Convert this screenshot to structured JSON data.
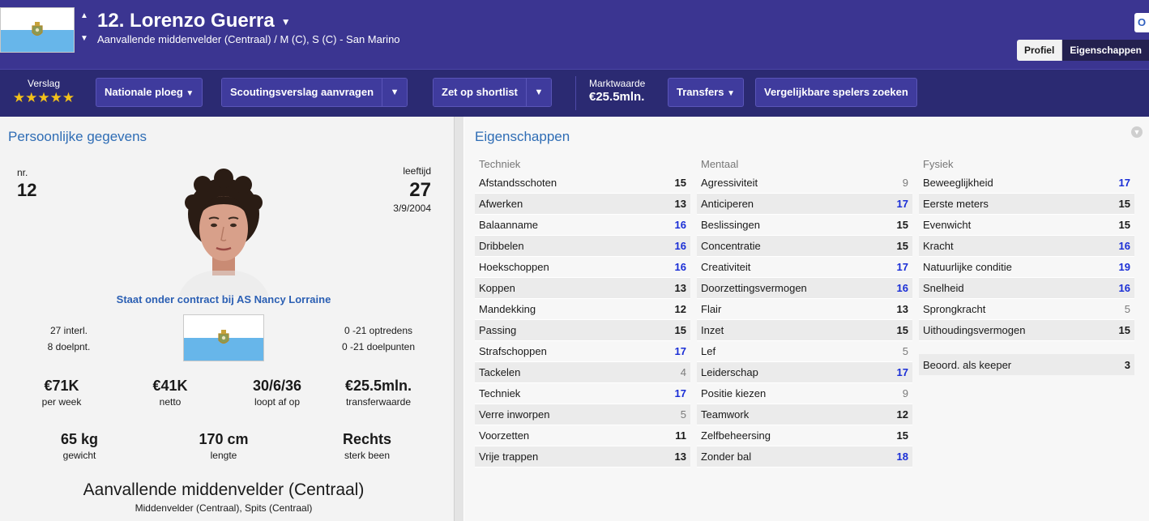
{
  "header": {
    "player_name": "12. Lorenzo Guerra",
    "subtitle": "Aanvallende middenvelder (Centraal) / M (C), S  (C) - San Marino",
    "corner_button": "O",
    "tabs": [
      {
        "label": "Profiel",
        "active": false
      },
      {
        "label": "Eigenschappen",
        "active": true
      }
    ],
    "colors": {
      "header_bg": "#3b3591",
      "toolbar_bg": "#2b2a72",
      "flag_blue": "#67b6ea"
    }
  },
  "toolbar": {
    "report_label": "Verslag",
    "report_stars": "★★★★★",
    "national_team": "Nationale ploeg",
    "scouting_request": "Scoutingsverslag aanvragen",
    "shortlist": "Zet op shortlist",
    "market_label": "Marktwaarde",
    "market_value": "€25.5mln.",
    "transfers": "Transfers",
    "similar_players": "Vergelijkbare spelers zoeken"
  },
  "personal": {
    "title": "Persoonlijke gegevens",
    "nr_label": "nr.",
    "nr_value": "12",
    "age_label": "leeftijd",
    "age_value": "27",
    "birth_date": "3/9/2004",
    "contract": "Staat onder contract bij AS Nancy Lorraine",
    "caps": "27 interl.",
    "goals": "8 doelpnt.",
    "u21_apps": "0 -21 optredens",
    "u21_goals": "0 -21 doelpunten",
    "wage_value": "€71K",
    "wage_label": "per week",
    "net_value": "€41K",
    "net_label": "netto",
    "expiry_value": "30/6/36",
    "expiry_label": "loopt af op",
    "transfer_value": "€25.5mln.",
    "transfer_label": "transferwaarde",
    "weight_value": "65 kg",
    "weight_label": "gewicht",
    "height_value": "170 cm",
    "height_label": "lengte",
    "foot_value": "Rechts",
    "foot_label": "sterk been",
    "position_main": "Aanvallende middenvelder (Centraal)",
    "position_sub": "Middenvelder (Centraal), Spits (Centraal)"
  },
  "attributes": {
    "title": "Eigenschappen",
    "technical": {
      "heading": "Techniek",
      "items": [
        {
          "name": "Afstandsschoten",
          "value": "15"
        },
        {
          "name": "Afwerken",
          "value": "13"
        },
        {
          "name": "Balaanname",
          "value": "16"
        },
        {
          "name": "Dribbelen",
          "value": "16"
        },
        {
          "name": "Hoekschoppen",
          "value": "16"
        },
        {
          "name": "Koppen",
          "value": "13"
        },
        {
          "name": "Mandekking",
          "value": "12"
        },
        {
          "name": "Passing",
          "value": "15"
        },
        {
          "name": "Strafschoppen",
          "value": "17"
        },
        {
          "name": "Tackelen",
          "value": "4"
        },
        {
          "name": "Techniek",
          "value": "17"
        },
        {
          "name": "Verre inworpen",
          "value": "5"
        },
        {
          "name": "Voorzetten",
          "value": "11"
        },
        {
          "name": "Vrije trappen",
          "value": "13"
        }
      ]
    },
    "mental": {
      "heading": "Mentaal",
      "items": [
        {
          "name": "Agressiviteit",
          "value": "9"
        },
        {
          "name": "Anticiperen",
          "value": "17"
        },
        {
          "name": "Beslissingen",
          "value": "15"
        },
        {
          "name": "Concentratie",
          "value": "15"
        },
        {
          "name": "Creativiteit",
          "value": "17"
        },
        {
          "name": "Doorzettingsvermogen",
          "value": "16"
        },
        {
          "name": "Flair",
          "value": "13"
        },
        {
          "name": "Inzet",
          "value": "15"
        },
        {
          "name": "Lef",
          "value": "5"
        },
        {
          "name": "Leiderschap",
          "value": "17"
        },
        {
          "name": "Positie kiezen",
          "value": "9"
        },
        {
          "name": "Teamwork",
          "value": "12"
        },
        {
          "name": "Zelfbeheersing",
          "value": "15"
        },
        {
          "name": "Zonder bal",
          "value": "18"
        }
      ]
    },
    "physical": {
      "heading": "Fysiek",
      "items": [
        {
          "name": "Beweeglijkheid",
          "value": "17"
        },
        {
          "name": "Eerste meters",
          "value": "15"
        },
        {
          "name": "Evenwicht",
          "value": "15"
        },
        {
          "name": "Kracht",
          "value": "16"
        },
        {
          "name": "Natuurlijke conditie",
          "value": "19"
        },
        {
          "name": "Snelheid",
          "value": "16"
        },
        {
          "name": "Sprongkracht",
          "value": "5"
        },
        {
          "name": "Uithoudingsvermogen",
          "value": "15"
        }
      ]
    },
    "keeper": {
      "name": "Beoord. als keeper",
      "value": "3"
    }
  }
}
